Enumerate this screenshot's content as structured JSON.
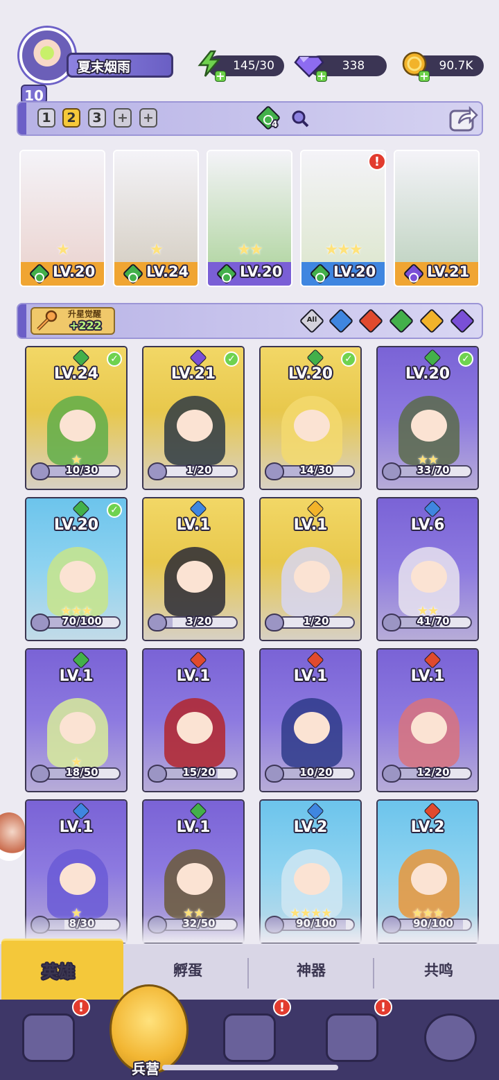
{
  "player": {
    "level": "10",
    "name": "夏末烟雨",
    "avatar_icon": "player-avatar"
  },
  "resources": {
    "energy": "145/30",
    "gems": "338",
    "coins": "90.7K"
  },
  "team_bar": {
    "tabs": [
      "1",
      "2",
      "3",
      "+",
      "+"
    ],
    "active_tab": "2",
    "element_count": "4"
  },
  "team_slots": [
    {
      "level": "LV.20",
      "element": "wind",
      "stars": "★",
      "band": "#f0a532",
      "alert": false
    },
    {
      "level": "LV.24",
      "element": "wind",
      "stars": "★",
      "band": "#f0a532",
      "alert": false
    },
    {
      "level": "LV.20",
      "element": "wind",
      "stars": "★★",
      "band": "#7a5fd6",
      "alert": false
    },
    {
      "level": "LV.20",
      "element": "wind",
      "stars": "★★★",
      "band": "#3f86e0",
      "alert": true
    },
    {
      "level": "LV.21",
      "element": "dark",
      "stars": "",
      "band": "#f0a532",
      "alert": false
    }
  ],
  "alert_mark": "!",
  "awaken": {
    "title": "升星觉醒",
    "count": "+222"
  },
  "filters": {
    "all_label": "All",
    "elements": [
      "water",
      "fire",
      "wind",
      "light",
      "dark"
    ]
  },
  "element_colors": {
    "wind": "#43b04a",
    "dark": "#7a4fd6",
    "water": "#3f86e0",
    "fire": "#e04a2e",
    "light": "#f2b32a"
  },
  "heroes": [
    {
      "level": "LV.24",
      "element": "wind",
      "stars": "★",
      "progress": "10/30",
      "fraction": 0.33,
      "frame": "gold",
      "owned": true,
      "tone": "#5fae4a"
    },
    {
      "level": "LV.21",
      "element": "dark",
      "stars": "",
      "progress": "1/20",
      "fraction": 0.05,
      "frame": "gold",
      "owned": true,
      "tone": "#2e3a44"
    },
    {
      "level": "LV.20",
      "element": "wind",
      "stars": "",
      "progress": "14/30",
      "fraction": 0.47,
      "frame": "gold",
      "owned": true,
      "tone": "#f3d96e"
    },
    {
      "level": "LV.20",
      "element": "wind",
      "stars": "★★",
      "progress": "33/70",
      "fraction": 0.47,
      "frame": "purple",
      "owned": true,
      "tone": "#5b6b4a"
    },
    {
      "level": "LV.20",
      "element": "wind",
      "stars": "★★★",
      "progress": "70/100",
      "fraction": 0.7,
      "frame": "blue",
      "owned": true,
      "tone": "#c8e58a"
    },
    {
      "level": "LV.1",
      "element": "water",
      "stars": "",
      "progress": "3/20",
      "fraction": 0.15,
      "frame": "gold",
      "owned": false,
      "tone": "#2a2a36"
    },
    {
      "level": "LV.1",
      "element": "light",
      "stars": "",
      "progress": "1/20",
      "fraction": 0.05,
      "frame": "gold",
      "owned": false,
      "tone": "#d7d6f2"
    },
    {
      "level": "LV.6",
      "element": "water",
      "stars": "★★",
      "progress": "41/70",
      "fraction": 0.59,
      "frame": "purple",
      "owned": false,
      "tone": "#e8e3ef"
    },
    {
      "level": "LV.1",
      "element": "wind",
      "stars": "★",
      "progress": "18/50",
      "fraction": 0.36,
      "frame": "purple",
      "owned": false,
      "tone": "#d8ec9a"
    },
    {
      "level": "LV.1",
      "element": "fire",
      "stars": "",
      "progress": "15/20",
      "fraction": 0.75,
      "frame": "purple",
      "owned": false,
      "tone": "#b3262c"
    },
    {
      "level": "LV.1",
      "element": "fire",
      "stars": "",
      "progress": "10/20",
      "fraction": 0.5,
      "frame": "purple",
      "owned": false,
      "tone": "#2e3b8a"
    },
    {
      "level": "LV.1",
      "element": "fire",
      "stars": "",
      "progress": "12/20",
      "fraction": 0.6,
      "frame": "purple",
      "owned": false,
      "tone": "#d9737c"
    },
    {
      "level": "LV.1",
      "element": "water",
      "stars": "★",
      "progress": "8/30",
      "fraction": 0.27,
      "frame": "purple",
      "owned": false,
      "tone": "#6a5ad6"
    },
    {
      "level": "LV.1",
      "element": "wind",
      "stars": "★★",
      "progress": "32/50",
      "fraction": 0.64,
      "frame": "purple",
      "owned": false,
      "tone": "#6b5b3a"
    },
    {
      "level": "LV.2",
      "element": "water",
      "stars": "★★★★",
      "progress": "90/100",
      "fraction": 0.9,
      "frame": "blue",
      "owned": false,
      "tone": "#cfe6f2"
    },
    {
      "level": "LV.2",
      "element": "fire",
      "stars": "★★★",
      "progress": "90/100",
      "fraction": 0.9,
      "frame": "blue",
      "owned": false,
      "tone": "#e9973a"
    }
  ],
  "sub_tabs": [
    "英雄",
    "孵蛋",
    "神器",
    "共鸣"
  ],
  "bottom_nav": {
    "active_label": "兵营",
    "items": [
      "cards",
      "barracks",
      "book",
      "temple",
      "mushroom"
    ]
  }
}
